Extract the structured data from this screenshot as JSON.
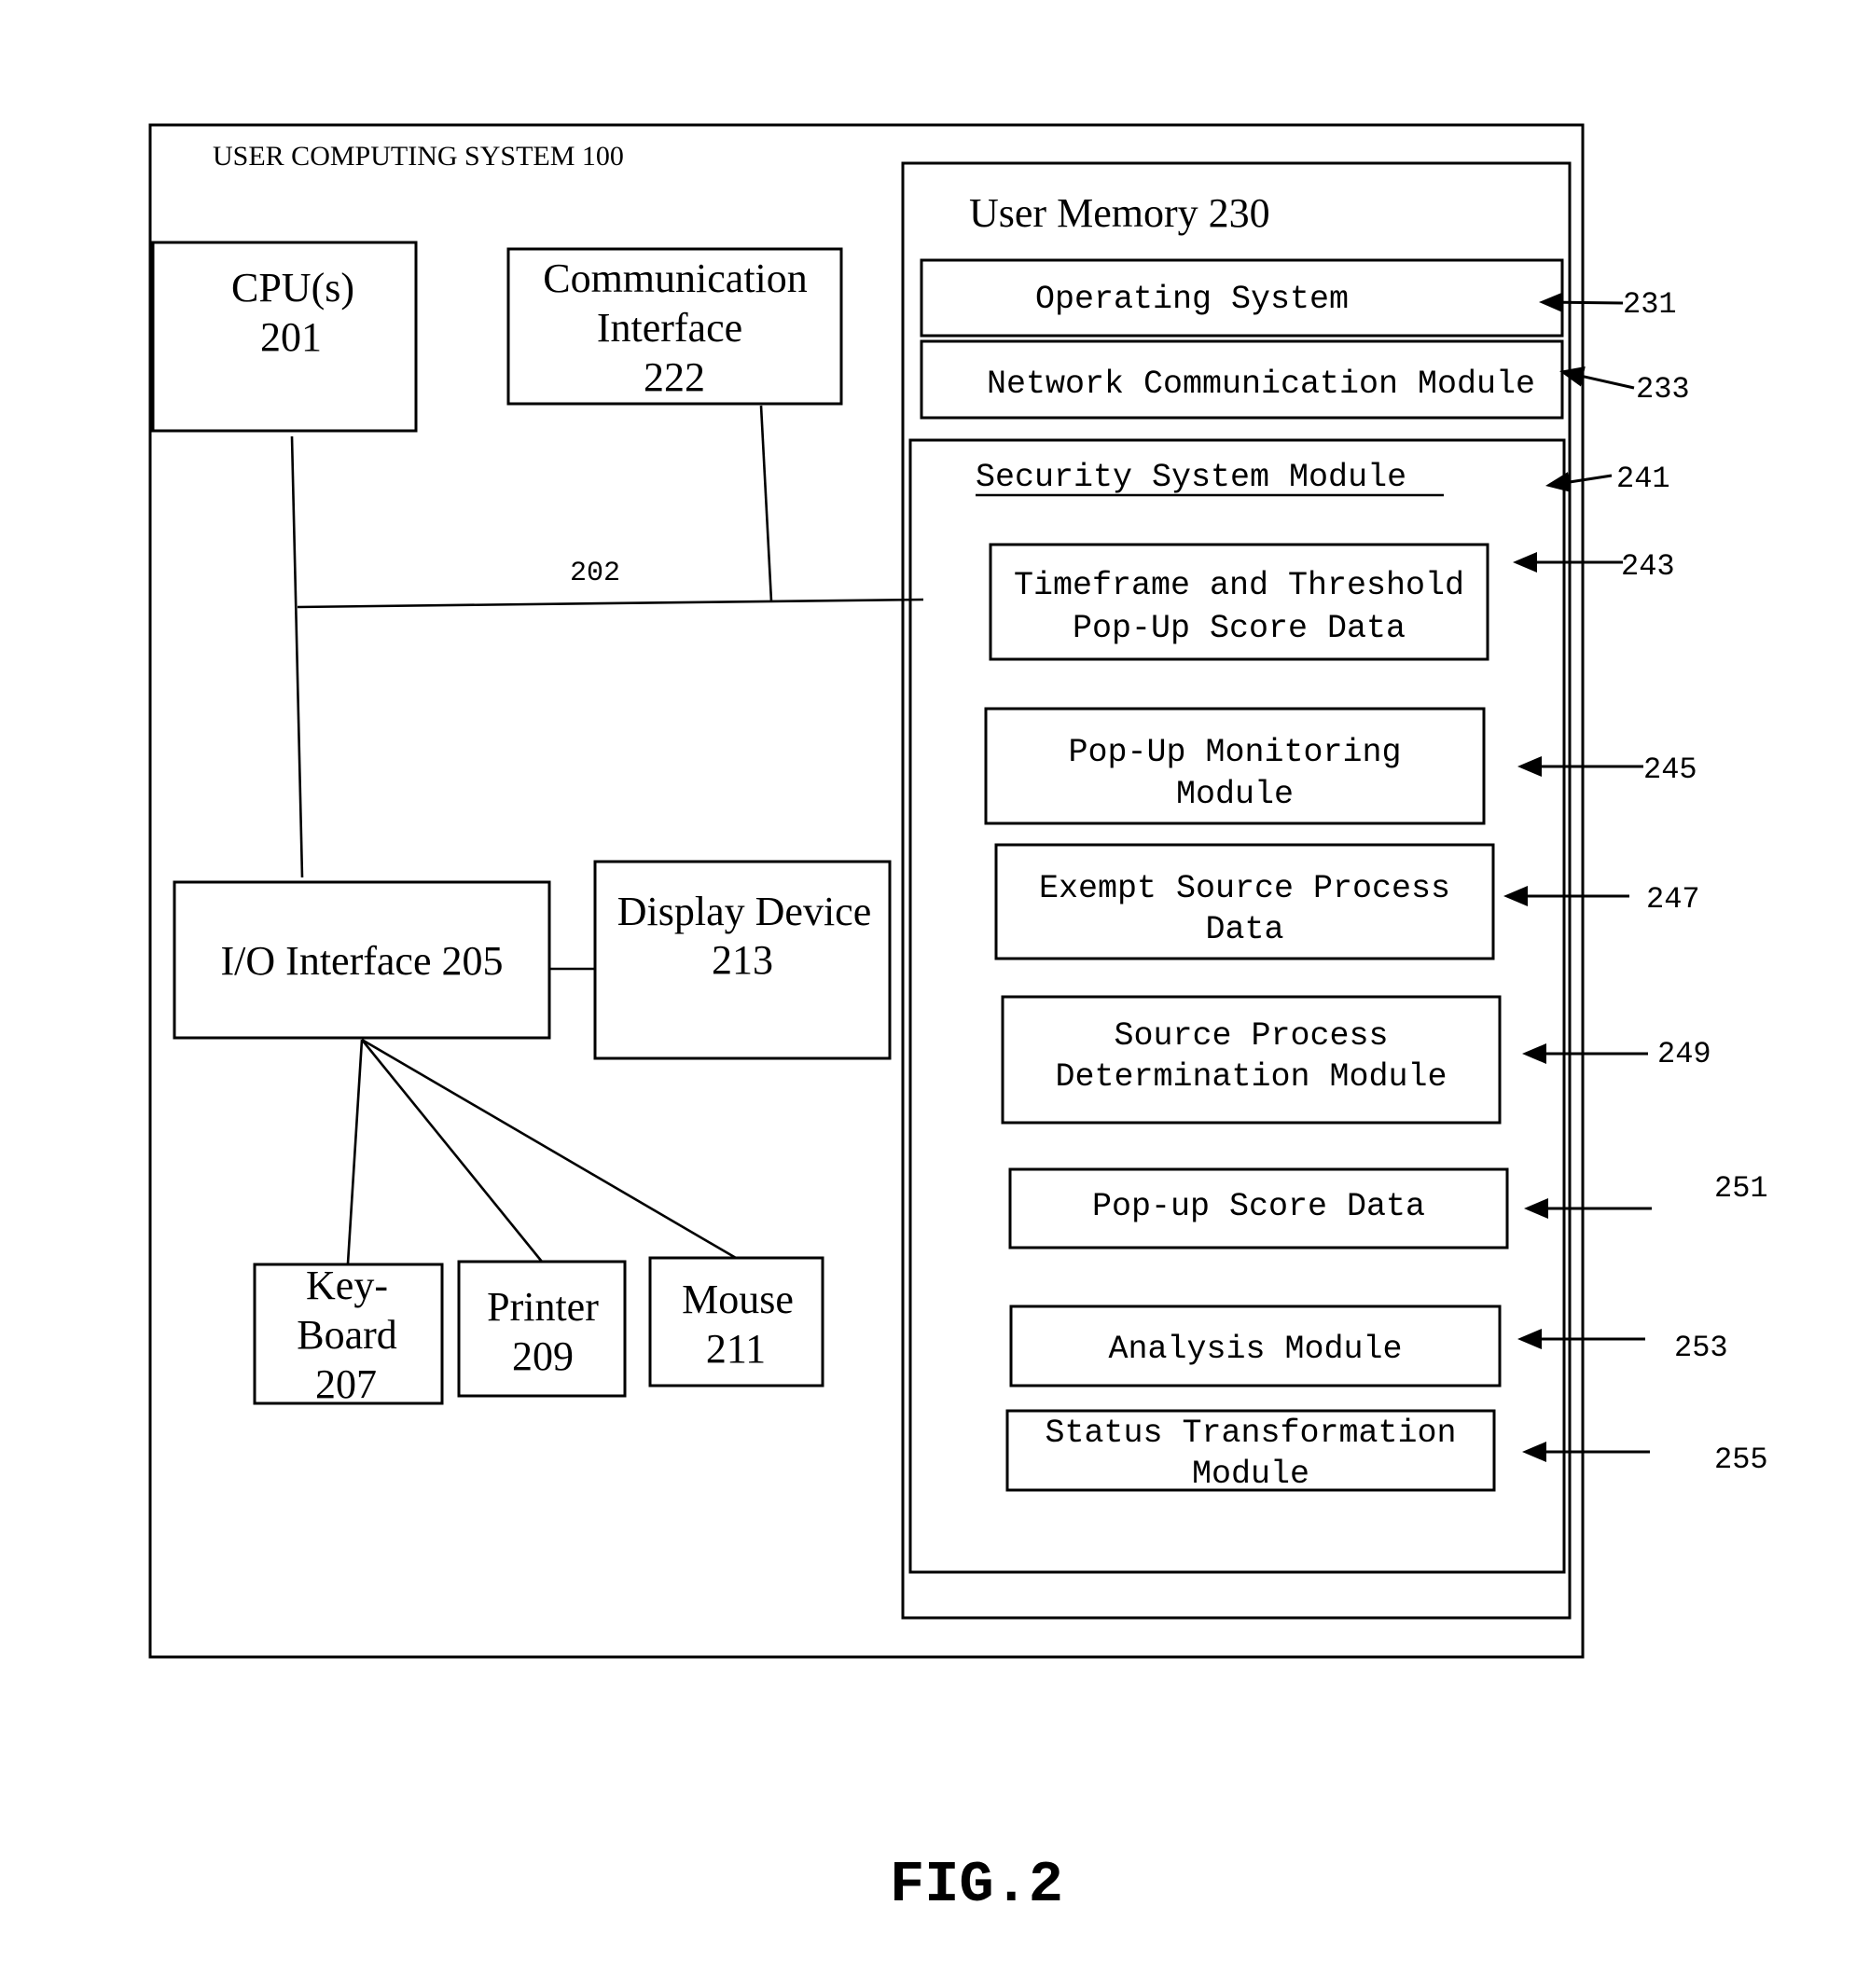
{
  "figure": {
    "caption": "FIG.2",
    "system_title": "USER COMPUTING SYSTEM 100",
    "bus_label": "202"
  },
  "hardware": {
    "cpu": {
      "line1": "CPU(s)",
      "line2": "201"
    },
    "comm_interface": {
      "line1": "Communication",
      "line2": "Interface",
      "line3": "222"
    },
    "io_interface": {
      "line1": "I/O Interface 205"
    },
    "display": {
      "line1": "Display Device",
      "line2": "213"
    },
    "keyboard": {
      "line1": "Key-",
      "line2": "Board",
      "line3": "207"
    },
    "printer": {
      "line1": "Printer",
      "line2": "209"
    },
    "mouse": {
      "line1": "Mouse",
      "line2": "211"
    }
  },
  "memory": {
    "title": "User Memory 230",
    "operating_system": {
      "label": "Operating System",
      "ref": "231"
    },
    "network_module": {
      "label": "Network Communication Module",
      "ref": "233"
    },
    "security_module": {
      "title": "Security System Module",
      "ref": "241",
      "items": [
        {
          "line1": "Timeframe and Threshold",
          "line2": "Pop-Up Score Data",
          "ref": "243"
        },
        {
          "line1": "Pop-Up Monitoring",
          "line2": "Module",
          "ref": "245"
        },
        {
          "line1": "Exempt Source Process",
          "line2": "Data",
          "ref": "247"
        },
        {
          "line1": "Source Process",
          "line2": "Determination Module",
          "ref": "249"
        },
        {
          "line1": "Pop-up Score Data",
          "line2": "",
          "ref": "251"
        },
        {
          "line1": "Analysis Module",
          "line2": "",
          "ref": "253"
        },
        {
          "line1": "Status Transformation",
          "line2": "Module",
          "ref": "255"
        }
      ]
    }
  }
}
